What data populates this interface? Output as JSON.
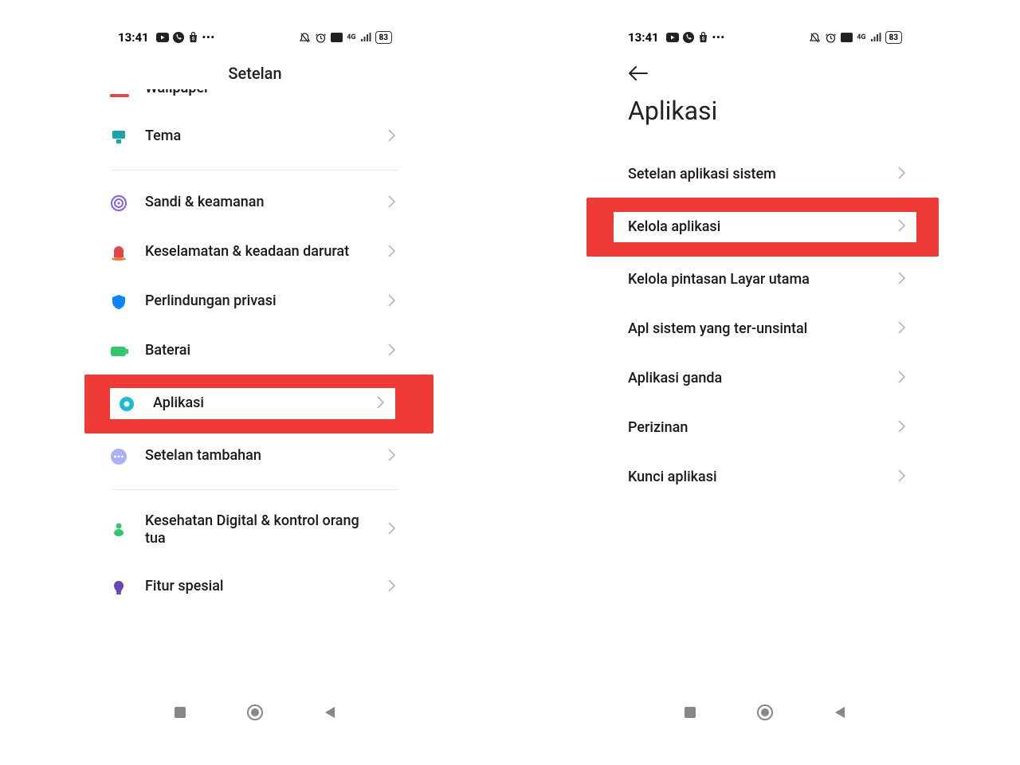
{
  "status": {
    "time": "13:41",
    "battery": "83"
  },
  "screen1": {
    "title": "Setelan",
    "rows": [
      {
        "icon": "wallpaper",
        "label": ""
      },
      {
        "icon": "theme",
        "label": "Tema"
      },
      {
        "icon": "fingerprint",
        "label": "Sandi & keamanan"
      },
      {
        "icon": "alarm",
        "label": "Keselamatan & keadaan darurat"
      },
      {
        "icon": "shield",
        "label": "Perlindungan privasi"
      },
      {
        "icon": "battery",
        "label": "Baterai"
      },
      {
        "icon": "gear",
        "label": "Aplikasi"
      },
      {
        "icon": "more",
        "label": "Setelan tambahan"
      },
      {
        "icon": "wellbeing",
        "label": "Kesehatan Digital & kontrol orang tua"
      },
      {
        "icon": "special",
        "label": "Fitur spesial"
      }
    ]
  },
  "screen2": {
    "title": "Aplikasi",
    "rows": [
      {
        "label": "Setelan aplikasi sistem"
      },
      {
        "label": "Kelola aplikasi"
      },
      {
        "label": "Kelola pintasan Layar utama"
      },
      {
        "label": "Apl sistem yang ter-unsintal"
      },
      {
        "label": "Aplikasi ganda"
      },
      {
        "label": "Perizinan"
      },
      {
        "label": "Kunci aplikasi"
      }
    ]
  }
}
